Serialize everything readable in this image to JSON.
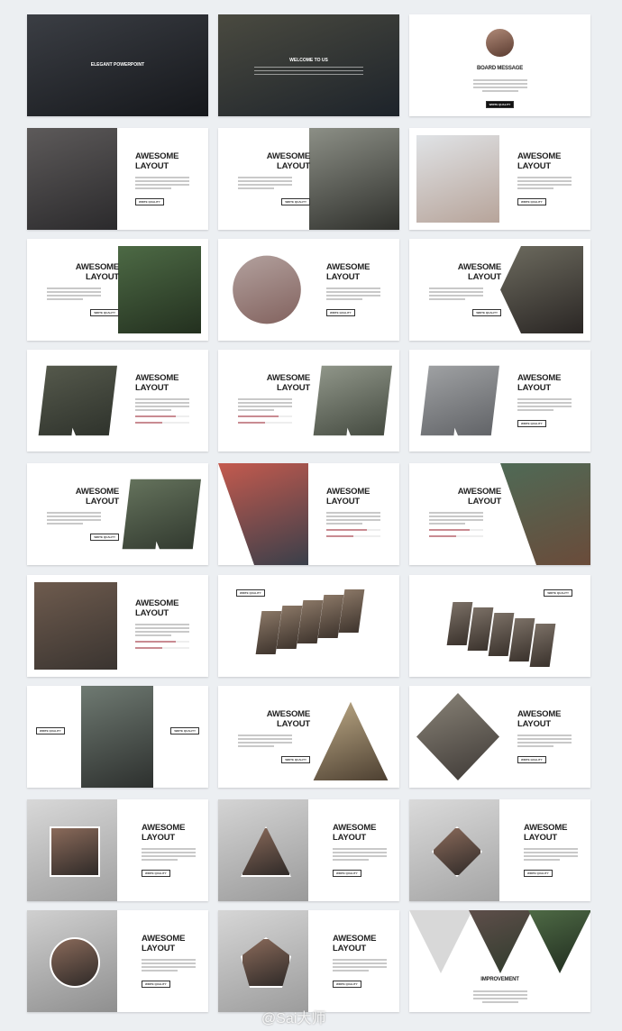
{
  "colors": {
    "background": "#eceff2",
    "bar_fill": "#c98b92",
    "title": "#222222"
  },
  "slides": [
    {
      "type": "cover",
      "title": "ELEGANT POWERPOINT",
      "photo": [
        "#3b3e44",
        "#15171b"
      ]
    },
    {
      "type": "cover",
      "title": "WELCOME TO US",
      "body": true,
      "photo": [
        "#4a4a40",
        "#1d232a"
      ]
    },
    {
      "type": "board",
      "title": "BOARD MESSAGE",
      "button": "WRITE QUALITY",
      "photo": [
        "#b08a78",
        "#5a3b30"
      ]
    },
    {
      "type": "split",
      "side": "left",
      "title": "AWESOME LAYOUT",
      "button": "WRITE QUALITY",
      "photo": [
        "#5d5a5a",
        "#2b2a2c"
      ]
    },
    {
      "type": "split",
      "side": "right",
      "title": "AWESOME LAYOUT",
      "button": "WRITE QUALITY",
      "photo": [
        "#8c8f86",
        "#2f302c"
      ]
    },
    {
      "type": "split",
      "side": "left",
      "inset": true,
      "title": "AWESOME LAYOUT",
      "button": "WRITE QUALITY",
      "photo": [
        "#e0e3e6",
        "#b7a49a"
      ]
    },
    {
      "type": "split",
      "side": "right",
      "inset": true,
      "title": "AWESOME LAYOUT",
      "button": "WRITE QUALITY",
      "photo": [
        "#4d6a45",
        "#23301f"
      ]
    },
    {
      "type": "split",
      "side": "left",
      "shape": "circle",
      "title": "AWESOME LAYOUT",
      "button": "WRITE QUALITY",
      "photo": [
        "#b9a9a6",
        "#7c5a56"
      ]
    },
    {
      "type": "split",
      "side": "right",
      "shape": "hexagon",
      "title": "AWESOME LAYOUT",
      "button": "WRITE QUALITY",
      "photo": [
        "#6d6b5f",
        "#2a2624"
      ]
    },
    {
      "type": "split",
      "side": "left",
      "shape": "slant",
      "title": "AWESOME LAYOUT",
      "bars": [
        0.75,
        0.5
      ],
      "photo": [
        "#5a5e50",
        "#2a2e28"
      ]
    },
    {
      "type": "split",
      "side": "right",
      "shape": "slant",
      "title": "AWESOME LAYOUT",
      "bars": [
        0.75,
        0.5
      ],
      "photo": [
        "#9aa093",
        "#3c4238"
      ]
    },
    {
      "type": "split",
      "side": "left",
      "shape": "slant",
      "title": "AWESOME LAYOUT",
      "button": "WRITE QUALITY",
      "photo": [
        "#a7a9ab",
        "#5a5c60"
      ]
    },
    {
      "type": "split",
      "side": "right",
      "shape": "slant",
      "title": "AWESOME LAYOUT",
      "button": "WRITE QUALITY",
      "photo": [
        "#6b7a62",
        "#2c332a"
      ]
    },
    {
      "type": "split",
      "side": "left",
      "shape": "diagonal",
      "title": "AWESOME LAYOUT",
      "bars": [
        0.75,
        0.5
      ],
      "photo": [
        "#c45a4e",
        "#3a3f4a"
      ]
    },
    {
      "type": "split",
      "side": "right",
      "shape": "diagonal",
      "title": "AWESOME LAYOUT",
      "bars": [
        0.75,
        0.5
      ],
      "photo": [
        "#4f6a56",
        "#6a4b3a"
      ]
    },
    {
      "type": "split",
      "side": "left",
      "inset": true,
      "title": "AWESOME LAYOUT",
      "bars": [
        0.75,
        0.5
      ],
      "photo": [
        "#6e5b4e",
        "#3a3430"
      ]
    },
    {
      "type": "strips",
      "button": "WRITE QUALITY",
      "photo": [
        "#8a7766",
        "#3e342d"
      ]
    },
    {
      "type": "strips",
      "button": "WRITE QUALITY",
      "photo": [
        "#7b7066",
        "#3a322c"
      ]
    },
    {
      "type": "center",
      "button": "WRITE QUALITY",
      "button2": "WRITE QUALITY",
      "photo": [
        "#6f7a72",
        "#2d302e"
      ]
    },
    {
      "type": "split",
      "side": "right",
      "shape": "triangle",
      "title": "AWESOME LAYOUT",
      "button": "WRITE QUALITY",
      "photo": [
        "#c9b58f",
        "#4b3e30"
      ]
    },
    {
      "type": "split",
      "side": "left",
      "shape": "diamond",
      "title": "AWESOME LAYOUT",
      "button": "WRITE QUALITY",
      "photo": [
        "#8a8478",
        "#3d3835"
      ]
    },
    {
      "type": "split",
      "side": "left",
      "shape": "frame",
      "title": "AWESOME LAYOUT",
      "button": "WRITE QUALITY",
      "photo": [
        "#d8d8d8",
        "#a0a0a0"
      ]
    },
    {
      "type": "split",
      "side": "left",
      "shape": "frame-tri",
      "title": "AWESOME LAYOUT",
      "button": "WRITE QUALITY",
      "photo": [
        "#d4d4d4",
        "#9a9a9a"
      ]
    },
    {
      "type": "split",
      "side": "left",
      "shape": "frame-diamond",
      "title": "AWESOME LAYOUT",
      "button": "WRITE QUALITY",
      "photo": [
        "#dadada",
        "#a4a4a4"
      ]
    },
    {
      "type": "split",
      "side": "left",
      "shape": "frame-circle",
      "title": "AWESOME LAYOUT",
      "button": "WRITE QUALITY",
      "photo": [
        "#d0d0d0",
        "#8f8f8f"
      ]
    },
    {
      "type": "split",
      "side": "left",
      "shape": "frame-pentagon",
      "title": "AWESOME LAYOUT",
      "button": "WRITE QUALITY",
      "photo": [
        "#d6d6d6",
        "#9c9c9c"
      ]
    },
    {
      "type": "improvement",
      "title": "IMPROVEMENT",
      "button": "WRITE QUALITY",
      "photo": [
        "#5e4e4a",
        "#2f3b2c"
      ]
    }
  ],
  "watermark": "@Sai大师"
}
